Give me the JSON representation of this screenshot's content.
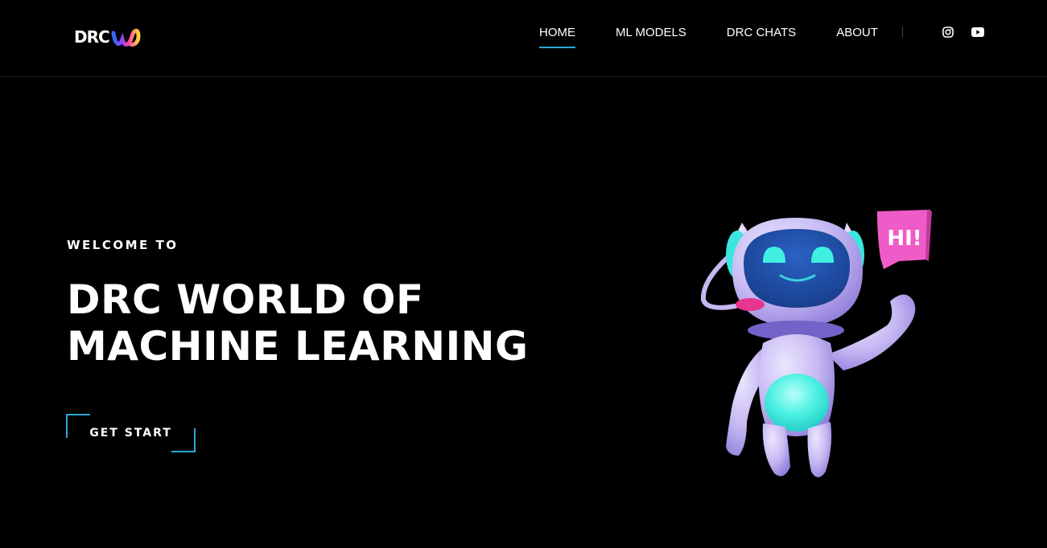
{
  "brand": {
    "logo_text": "DRC",
    "logo_icon": "rainbow-w-mark-icon"
  },
  "nav": {
    "items": [
      {
        "label": "HOME",
        "active": true
      },
      {
        "label": "ML MODELS",
        "active": false
      },
      {
        "label": "DRC CHATS",
        "active": false
      },
      {
        "label": "ABOUT",
        "active": false
      }
    ],
    "social": [
      {
        "icon": "instagram-icon"
      },
      {
        "icon": "youtube-icon"
      }
    ]
  },
  "hero": {
    "eyebrow": "WELCOME TO",
    "title_line1": "DRC WORLD OF",
    "title_line2": "MACHINE LEARNING",
    "cta_label": "GET START",
    "illustration": {
      "speech_bubble_text": "HI!",
      "icon": "waving-robot-illustration"
    }
  },
  "colors": {
    "background": "#000000",
    "accent": "#2ea6d6",
    "robot_body": "#c5b8f2",
    "robot_visor": "#1f4fa8",
    "robot_glow": "#3ff0e0",
    "bubble": "#f05cc7"
  }
}
